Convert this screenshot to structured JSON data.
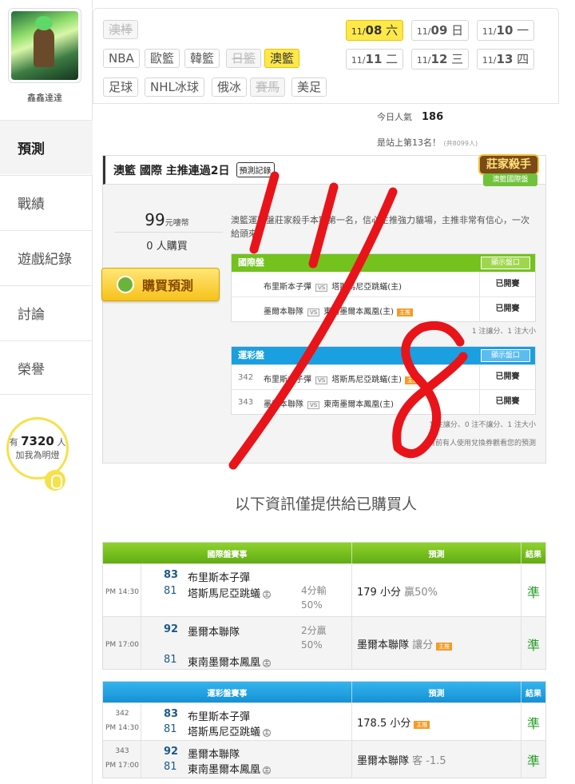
{
  "user": {
    "nickname": "鑫鑫達達",
    "fans_prefix": "有",
    "fans_count": "7320",
    "fans_suffix": "人",
    "fans_cta": "加我為明燈"
  },
  "nav": [
    {
      "label": "預測"
    },
    {
      "label": "戰績"
    },
    {
      "label": "遊戲紀錄"
    },
    {
      "label": "討論"
    },
    {
      "label": "榮譽"
    }
  ],
  "sports": [
    {
      "label": "澳棒"
    },
    {
      "label": "NBA"
    },
    {
      "label": "歐籃"
    },
    {
      "label": "韓籃"
    },
    {
      "label": "日籃"
    },
    {
      "label": "澳籃"
    },
    {
      "label": "足球"
    },
    {
      "label": "NHL冰球"
    },
    {
      "label": "俄冰"
    },
    {
      "label": "賽馬"
    },
    {
      "label": "美足"
    }
  ],
  "dates": [
    {
      "m": "11/",
      "d": "08",
      "w": "六"
    },
    {
      "m": "11/",
      "d": "09",
      "w": "日"
    },
    {
      "m": "11/",
      "d": "10",
      "w": "一"
    },
    {
      "m": "11/",
      "d": "11",
      "w": "二"
    },
    {
      "m": "11/",
      "d": "12",
      "w": "三"
    },
    {
      "m": "11/",
      "d": "13",
      "w": "四"
    }
  ],
  "popularity": {
    "label": "今日人氣",
    "value": "186",
    "rank_text": "是站上第13名！",
    "rank_total": "(共8099人)"
  },
  "prediction": {
    "title": "澳籃 國際 主推連過2日",
    "record_link": "預測記錄",
    "badge_top": "莊家殺手",
    "badge_bottom": "澳籃國際盤",
    "price_value": "99",
    "price_unit": "元嘍幣",
    "buyers_count": "0",
    "buyers_label": "人購買",
    "buy_label": "購買預測",
    "description": "澳籃運彩盤莊家殺手本期第一名，信心主推強力貓場，主推非常有信心，一次給頭來。",
    "intl": {
      "title": "國際盤",
      "show_btn": "顯示盤口",
      "rows": [
        {
          "no": "",
          "away": "布里斯本子彈",
          "home": "塔斯馬尼亞跳蟻(主)",
          "master": "",
          "status": "已開賽"
        },
        {
          "no": "",
          "away": "墨爾本聯隊",
          "home": "東南墨爾本鳳凰(主)",
          "master": "主推",
          "status": "已開賽"
        }
      ],
      "footer": "1 注讓分、1 注大小"
    },
    "lottery": {
      "title": "運彩盤",
      "show_btn": "顯示盤口",
      "rows": [
        {
          "no": "342",
          "away": "布里斯本子彈",
          "home": "塔斯馬尼亞跳蟻(主)",
          "master": "主推",
          "status": "已開賽"
        },
        {
          "no": "343",
          "away": "墨爾本聯隊",
          "home": "東南墨爾本鳳凰(主)",
          "master": "",
          "status": "已開賽"
        }
      ],
      "footer": "1 注讓分、0 注不讓分、1 注大小",
      "footer2": "目前有人使用兌換券觀看您的預測"
    }
  },
  "info_notice": "以下資訊僅提供給已購買人",
  "intl_results": {
    "headers": [
      "國際盤賽事",
      "預測",
      "結果"
    ],
    "rows": [
      {
        "time": "PM 14:30",
        "no": "",
        "away_score": "83",
        "away": "布里斯本子彈",
        "home_score": "81",
        "home": "塔斯馬尼亞跳蟻",
        "home_mark": "主",
        "hc1": "4分輸",
        "hc2": "50%",
        "pick": "179 小分",
        "pick_note": "贏50%",
        "pick_badge": "",
        "result": "準"
      },
      {
        "time": "PM 17:00",
        "no": "",
        "away_score": "92",
        "away": "墨爾本聯隊",
        "home_score": "81",
        "home": "東南墨爾本鳳凰",
        "home_mark": "主",
        "hc1": "2分贏",
        "hc2": "50%",
        "pick": "墨爾本聯隊",
        "pick_note": "讓分",
        "pick_badge": "主推",
        "result": "準"
      }
    ]
  },
  "lottery_results": {
    "headers": [
      "運彩盤賽事",
      "預測",
      "結果"
    ],
    "rows": [
      {
        "time": "PM 14:30",
        "no": "342",
        "away_score": "83",
        "away": "布里斯本子彈",
        "home_score": "81",
        "home": "塔斯馬尼亞跳蟻",
        "home_mark": "主",
        "pick": "178.5 小分",
        "pick_note": "",
        "pick_badge": "主推",
        "result": "準"
      },
      {
        "time": "PM 17:00",
        "no": "343",
        "away_score": "92",
        "away": "墨爾本聯隊",
        "home_score": "81",
        "home": "東南墨爾本鳳凰",
        "home_mark": "主",
        "pick": "墨爾本聯隊",
        "pick_note": "客 -1.5",
        "pick_badge": "",
        "result": "準"
      }
    ]
  },
  "colors": {
    "accent_yellow": "#ffe84a",
    "green": "#73c21d",
    "blue": "#1a9fe0",
    "scribble_red": "#e8141a"
  }
}
